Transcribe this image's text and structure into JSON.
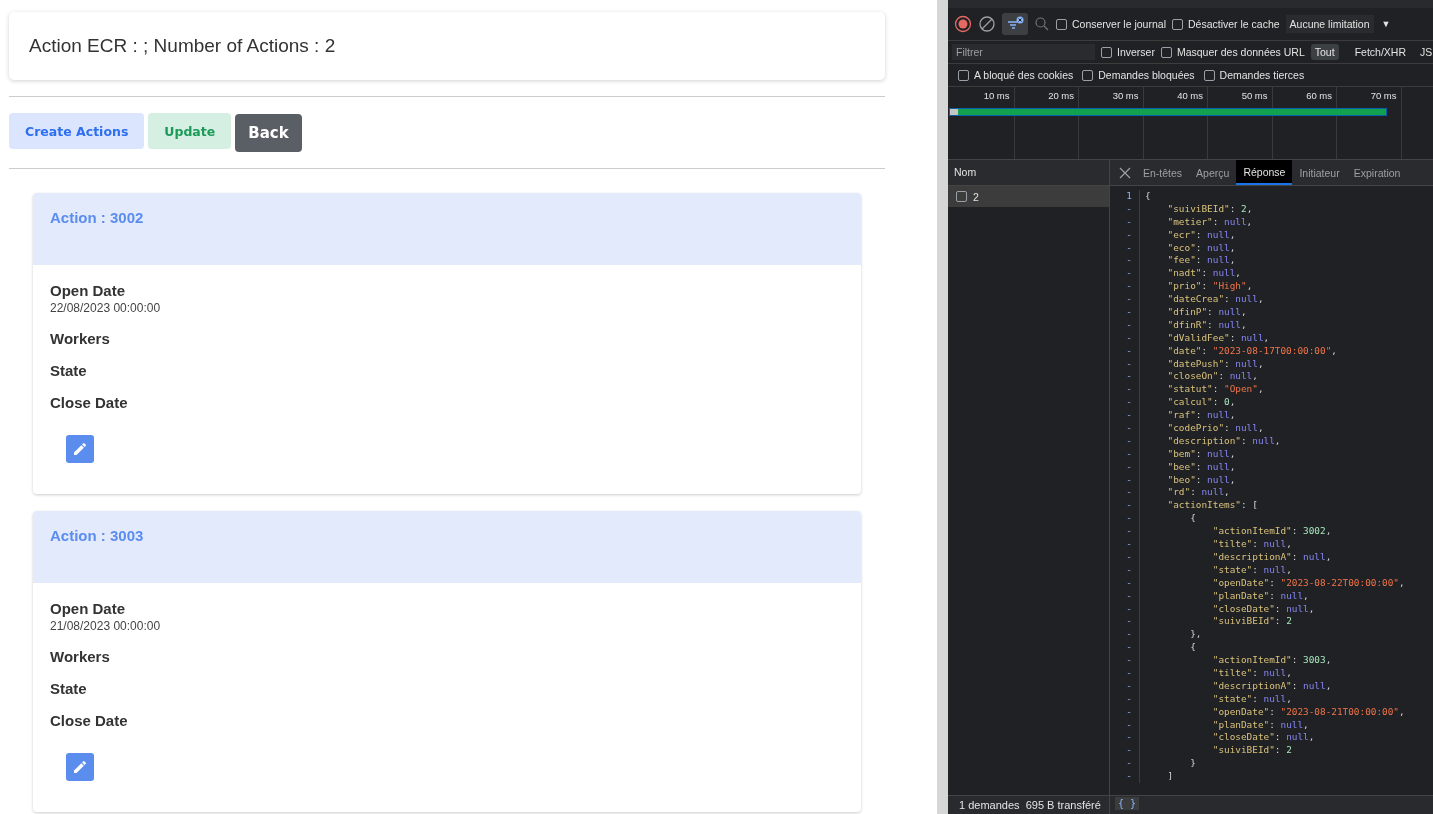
{
  "page": {
    "title": "Action ECR : ; Number of Actions : 2",
    "buttons": [
      {
        "label": "Create Actions",
        "kind": "primary"
      },
      {
        "label": "Update",
        "kind": "success"
      },
      {
        "label": "Back",
        "kind": "dark"
      }
    ],
    "cards": [
      {
        "title": "Action : 3002",
        "fields": [
          {
            "label": "Open Date",
            "value": "22/08/2023 00:00:00"
          },
          {
            "label": "Workers"
          },
          {
            "label": "State"
          },
          {
            "label": "Close Date"
          }
        ]
      },
      {
        "title": "Action : 3003",
        "fields": [
          {
            "label": "Open Date",
            "value": "21/08/2023 00:00:00"
          },
          {
            "label": "Workers"
          },
          {
            "label": "State"
          },
          {
            "label": "Close Date"
          }
        ]
      }
    ]
  },
  "devtools": {
    "filter_toggle": {
      "on": true
    },
    "options": [
      {
        "label": "Conserver le journal",
        "checked": false
      },
      {
        "label": "Désactiver le cache",
        "checked": false
      }
    ],
    "throttling": {
      "value": "Aucune limitation",
      "caret": "▼"
    },
    "filter": {
      "placeholder": "Filtrer"
    },
    "filter_options": [
      {
        "label": "Inverser",
        "checked": false
      },
      {
        "label": "Masquer des données URL",
        "checked": false
      }
    ],
    "type_filters": [
      {
        "label": "Tout",
        "selected": true
      },
      {
        "label": "Fetch/XHR",
        "selected": false
      },
      {
        "label": "JS",
        "selected": false
      }
    ],
    "more_options": [
      {
        "label": "A bloqué des cookies",
        "checked": false
      },
      {
        "label": "Demandes bloquées",
        "checked": false
      },
      {
        "label": "Demandes tierces",
        "checked": false
      }
    ],
    "timeline_ticks": [
      "10 ms",
      "20 ms",
      "30 ms",
      "40 ms",
      "50 ms",
      "60 ms",
      "70 ms"
    ],
    "requests": {
      "header": "Nom",
      "rows": [
        {
          "name": "2",
          "selected": true,
          "checked": false
        }
      ]
    },
    "detail_tabs": [
      {
        "label": "En-têtes",
        "selected": false
      },
      {
        "label": "Aperçu",
        "selected": false
      },
      {
        "label": "Réponse",
        "selected": true
      },
      {
        "label": "Initiateur",
        "selected": false
      },
      {
        "label": "Expiration",
        "selected": false
      }
    ],
    "response": [
      {
        "gutter": "1",
        "text": "{"
      },
      {
        "gutter": "-",
        "text": "    \"suiviBEId\": 2,"
      },
      {
        "gutter": "-",
        "text": "    \"metier\": null,"
      },
      {
        "gutter": "-",
        "text": "    \"ecr\": null,"
      },
      {
        "gutter": "-",
        "text": "    \"eco\": null,"
      },
      {
        "gutter": "-",
        "text": "    \"fee\": null,"
      },
      {
        "gutter": "-",
        "text": "    \"nadt\": null,"
      },
      {
        "gutter": "-",
        "text": "    \"prio\": \"High\","
      },
      {
        "gutter": "-",
        "text": "    \"dateCrea\": null,"
      },
      {
        "gutter": "-",
        "text": "    \"dfinP\": null,"
      },
      {
        "gutter": "-",
        "text": "    \"dfinR\": null,"
      },
      {
        "gutter": "-",
        "text": "    \"dValidFee\": null,"
      },
      {
        "gutter": "-",
        "text": "    \"date\": \"2023-08-17T00:00:00\","
      },
      {
        "gutter": "-",
        "text": "    \"datePush\": null,"
      },
      {
        "gutter": "-",
        "text": "    \"closeOn\": null,"
      },
      {
        "gutter": "-",
        "text": "    \"statut\": \"Open\","
      },
      {
        "gutter": "-",
        "text": "    \"calcul\": 0,"
      },
      {
        "gutter": "-",
        "text": "    \"raf\": null,"
      },
      {
        "gutter": "-",
        "text": "    \"codePrio\": null,"
      },
      {
        "gutter": "-",
        "text": "    \"description\": null,"
      },
      {
        "gutter": "-",
        "text": "    \"bem\": null,"
      },
      {
        "gutter": "-",
        "text": "    \"bee\": null,"
      },
      {
        "gutter": "-",
        "text": "    \"beo\": null,"
      },
      {
        "gutter": "-",
        "text": "    \"rd\": null,"
      },
      {
        "gutter": "-",
        "text": "    \"actionItems\": ["
      },
      {
        "gutter": "-",
        "text": "        {"
      },
      {
        "gutter": "-",
        "text": "            \"actionItemId\": 3002,"
      },
      {
        "gutter": "-",
        "text": "            \"tilte\": null,"
      },
      {
        "gutter": "-",
        "text": "            \"descriptionA\": null,"
      },
      {
        "gutter": "-",
        "text": "            \"state\": null,"
      },
      {
        "gutter": "-",
        "text": "            \"openDate\": \"2023-08-22T00:00:00\","
      },
      {
        "gutter": "-",
        "text": "            \"planDate\": null,"
      },
      {
        "gutter": "-",
        "text": "            \"closeDate\": null,"
      },
      {
        "gutter": "-",
        "text": "            \"suiviBEId\": 2"
      },
      {
        "gutter": "-",
        "text": "        },"
      },
      {
        "gutter": "-",
        "text": "        {"
      },
      {
        "gutter": "-",
        "text": "            \"actionItemId\": 3003,"
      },
      {
        "gutter": "-",
        "text": "            \"tilte\": null,"
      },
      {
        "gutter": "-",
        "text": "            \"descriptionA\": null,"
      },
      {
        "gutter": "-",
        "text": "            \"state\": null,"
      },
      {
        "gutter": "-",
        "text": "            \"openDate\": \"2023-08-21T00:00:00\","
      },
      {
        "gutter": "-",
        "text": "            \"planDate\": null,"
      },
      {
        "gutter": "-",
        "text": "            \"closeDate\": null,"
      },
      {
        "gutter": "-",
        "text": "            \"suiviBEId\": 2"
      },
      {
        "gutter": "-",
        "text": "        }"
      },
      {
        "gutter": "-",
        "text": "    ]"
      }
    ],
    "status": "1 demandes  695 B transféré",
    "format_button": "{ }"
  }
}
